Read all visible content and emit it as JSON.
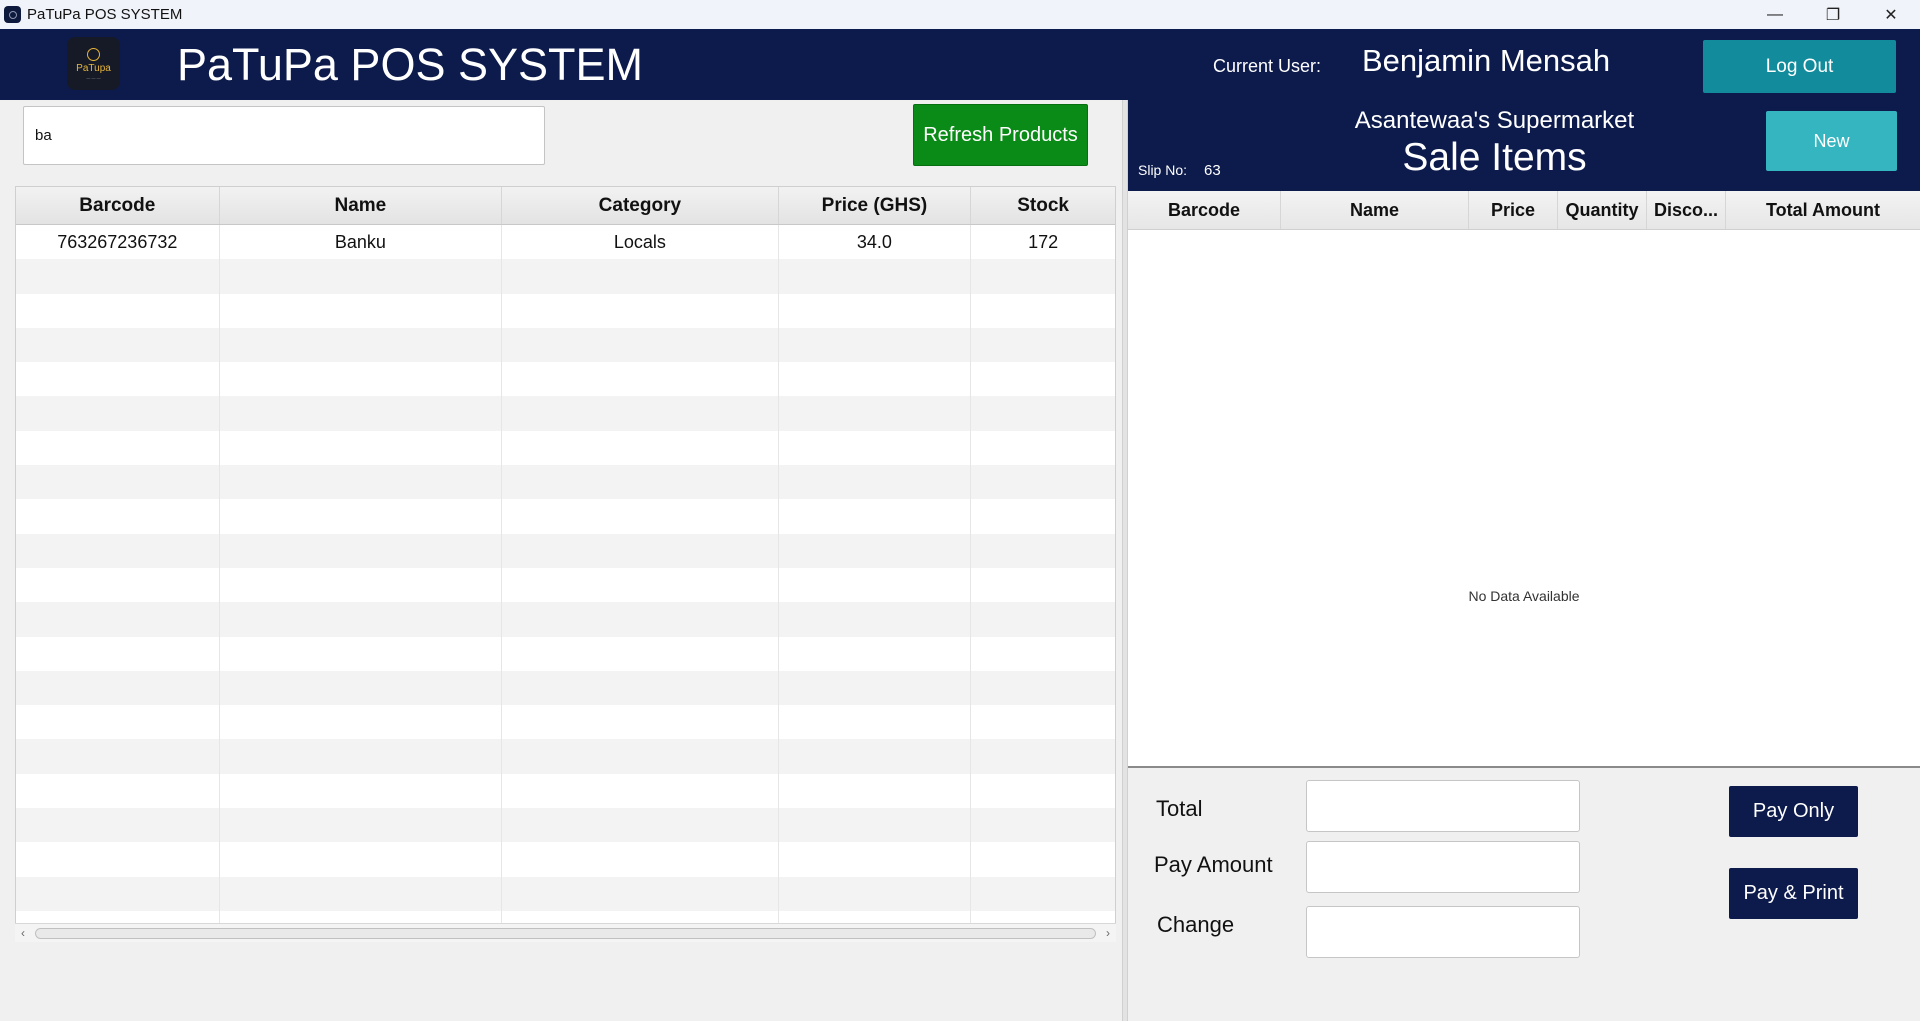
{
  "window": {
    "title": "PaTuPa POS SYSTEM"
  },
  "header": {
    "brand": "PaTuPa POS SYSTEM",
    "logo_text": "PaTupa",
    "current_user_label": "Current User:",
    "current_user": "Benjamin Mensah",
    "logout_label": "Log Out"
  },
  "products": {
    "search_value": "ba",
    "refresh_label": "Refresh Products",
    "columns": [
      "Barcode",
      "Name",
      "Category",
      "Price (GHS)",
      "Stock"
    ],
    "rows": [
      [
        "763267236732",
        "Banku",
        "Locals",
        "34.0",
        "172"
      ]
    ]
  },
  "sale": {
    "shop_name": "Asantewaa's Supermarket",
    "title": "Sale Items",
    "slip_label": "Slip No:",
    "slip_no": "63",
    "new_label": "New",
    "columns": [
      "Barcode",
      "Name",
      "Price",
      "Quantity",
      "Disco...",
      "Total Amount"
    ],
    "empty_text": "No Data Available",
    "total_label": "Total",
    "pay_amount_label": "Pay Amount",
    "change_label": "Change",
    "total_value": "",
    "pay_amount_value": "",
    "change_value": "",
    "pay_only_label": "Pay Only",
    "pay_print_label": "Pay & Print"
  },
  "colors": {
    "navy": "#0d1b4c",
    "teal": "#128c9c",
    "green": "#0a8a16",
    "cyan": "#35b5c0"
  }
}
